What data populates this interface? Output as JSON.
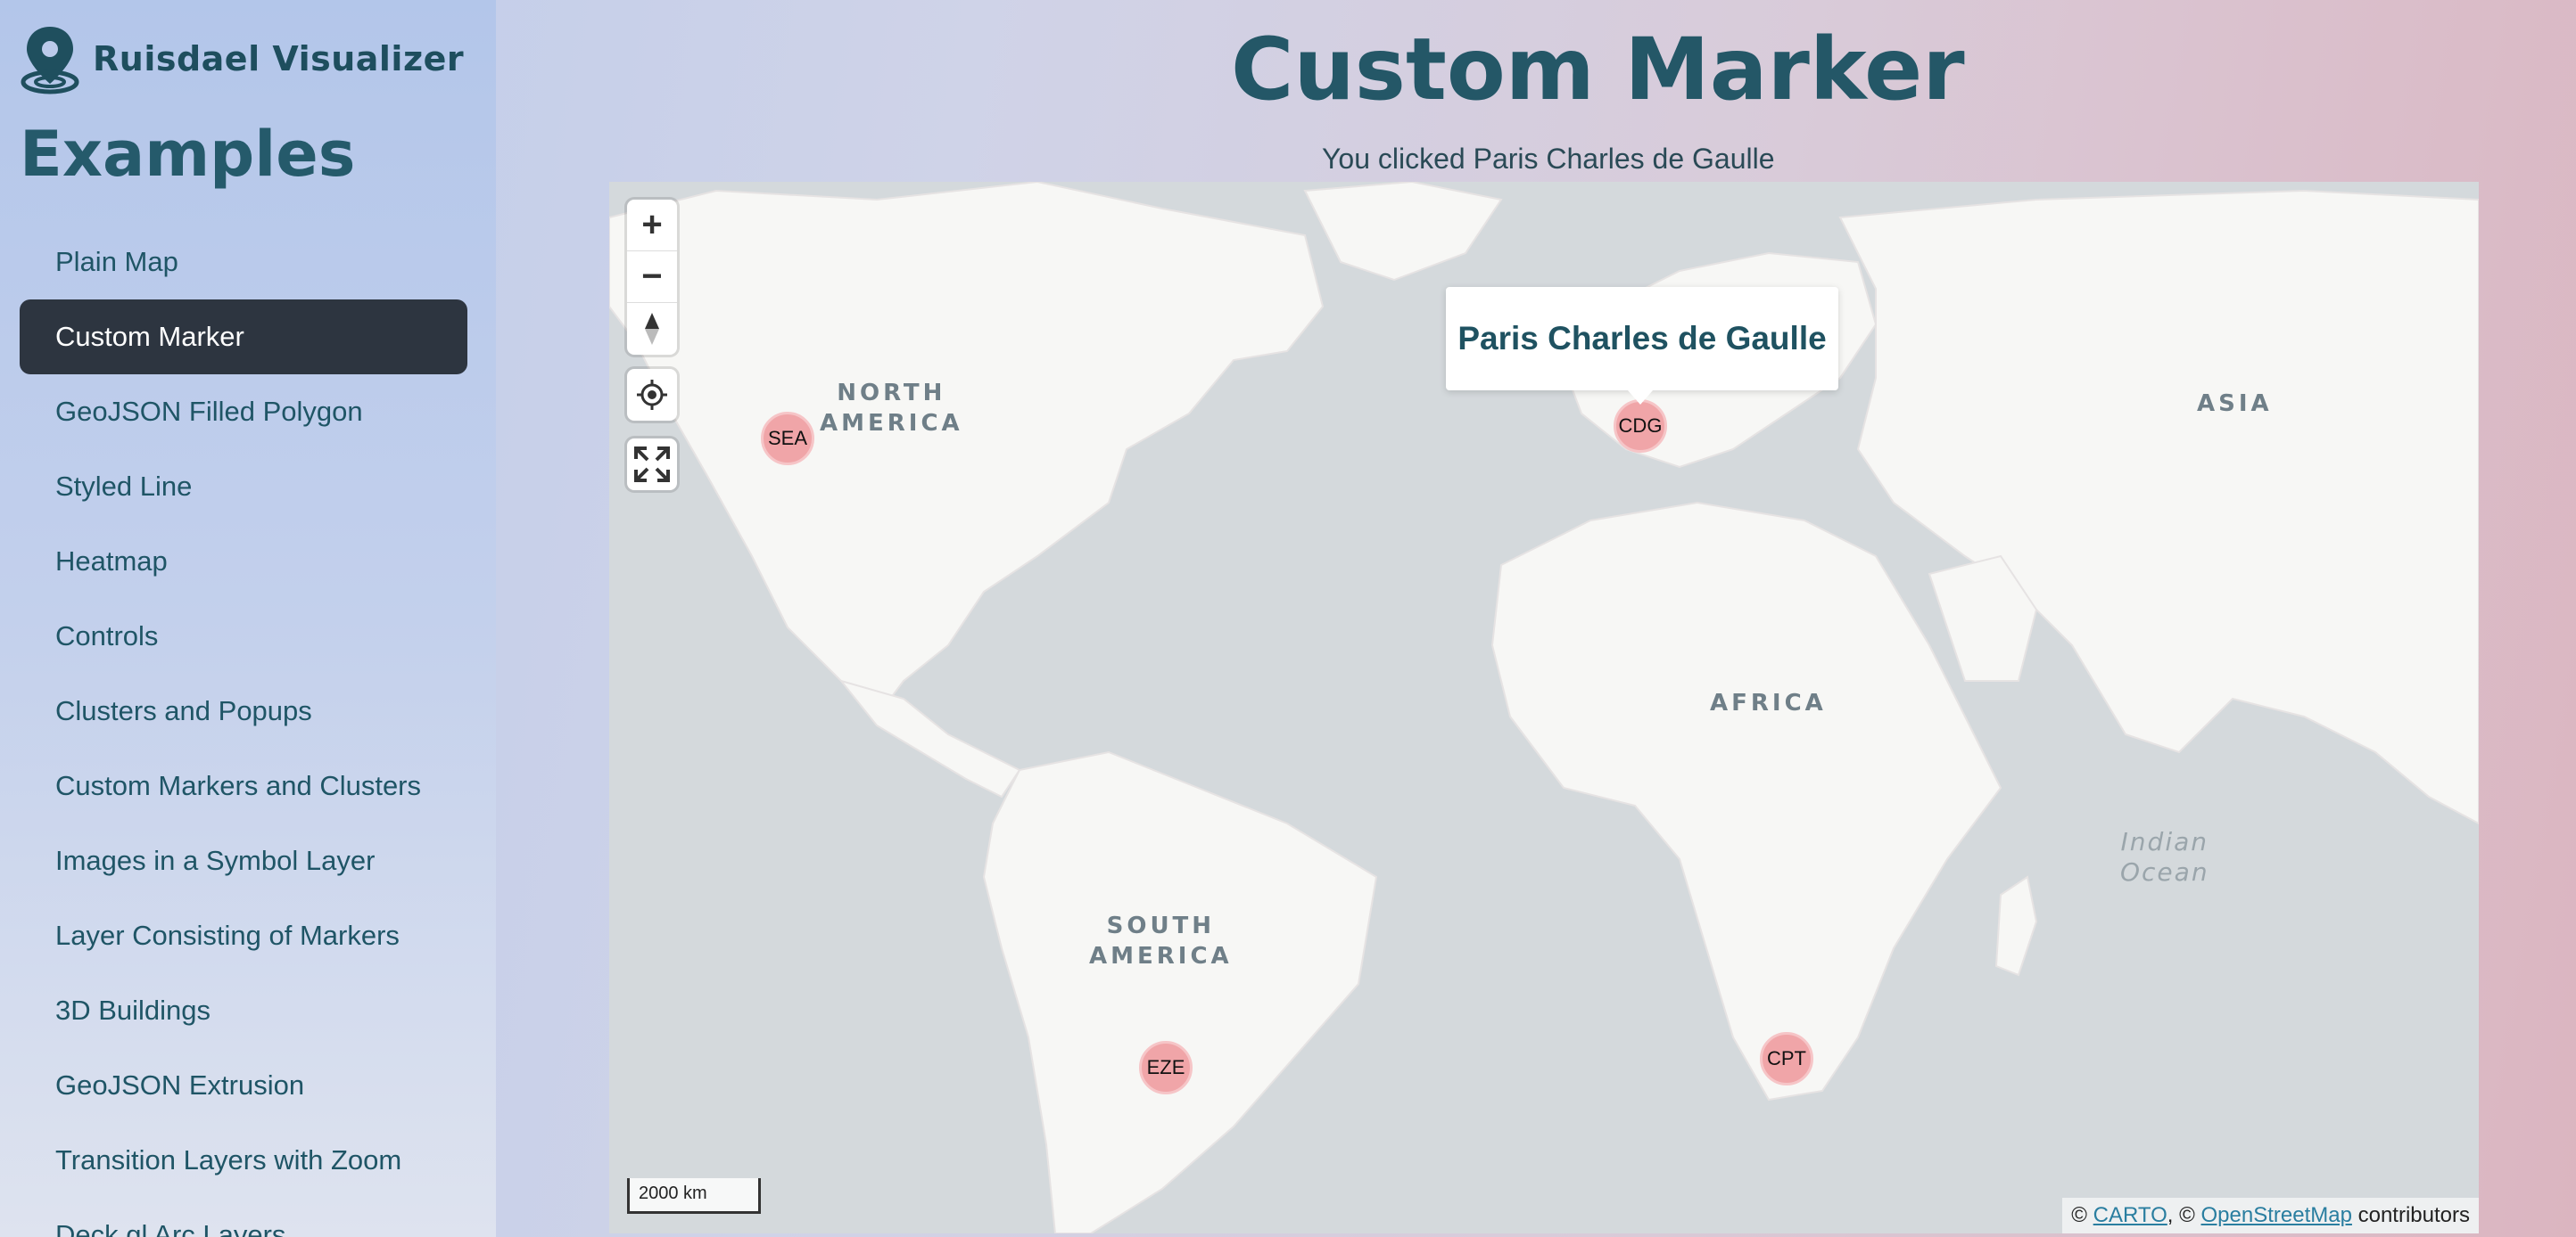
{
  "brand": {
    "name": "Ruisdael Visualizer",
    "logo_icon": "map-pin-logo-icon"
  },
  "sidebar": {
    "section_title": "Examples",
    "items": [
      {
        "label": "Plain Map",
        "active": false
      },
      {
        "label": "Custom Marker",
        "active": true
      },
      {
        "label": "GeoJSON Filled Polygon",
        "active": false
      },
      {
        "label": "Styled Line",
        "active": false
      },
      {
        "label": "Heatmap",
        "active": false
      },
      {
        "label": "Controls",
        "active": false
      },
      {
        "label": "Clusters and Popups",
        "active": false
      },
      {
        "label": "Custom Markers and Clusters",
        "active": false
      },
      {
        "label": "Images in a Symbol Layer",
        "active": false
      },
      {
        "label": "Layer Consisting of Markers",
        "active": false
      },
      {
        "label": "3D Buildings",
        "active": false
      },
      {
        "label": "GeoJSON Extrusion",
        "active": false
      },
      {
        "label": "Transition Layers with Zoom",
        "active": false
      },
      {
        "label": "Deck.gl Arc Layers",
        "active": false
      }
    ]
  },
  "main": {
    "title": "Custom Marker",
    "status": "You clicked Paris Charles de Gaulle"
  },
  "map": {
    "controls": {
      "zoom_in": "+",
      "zoom_out": "−",
      "icons": [
        "compass-icon",
        "geolocate-icon",
        "fullscreen-icon"
      ]
    },
    "continents": {
      "north_america": [
        "NORTH",
        "AMERICA"
      ],
      "south_america": [
        "SOUTH",
        "AMERICA"
      ],
      "africa": "AFRICA",
      "asia": "ASIA"
    },
    "oceans": {
      "indian": [
        "Indian",
        "Ocean"
      ]
    },
    "markers": {
      "sea": "SEA",
      "cdg": "CDG",
      "eze": "EZE",
      "cpt": "CPT"
    },
    "popup": {
      "title": "Paris Charles de Gaulle"
    },
    "scale": "2000 km",
    "attribution": {
      "prefix": "©",
      "carto": "CARTO",
      "sep": ", ©",
      "osm": "OpenStreetMap",
      "suffix": "contributors"
    },
    "colors": {
      "water": "#d4d9dc",
      "land": "#f7f7f5",
      "marker": "#f0a5a8"
    }
  }
}
